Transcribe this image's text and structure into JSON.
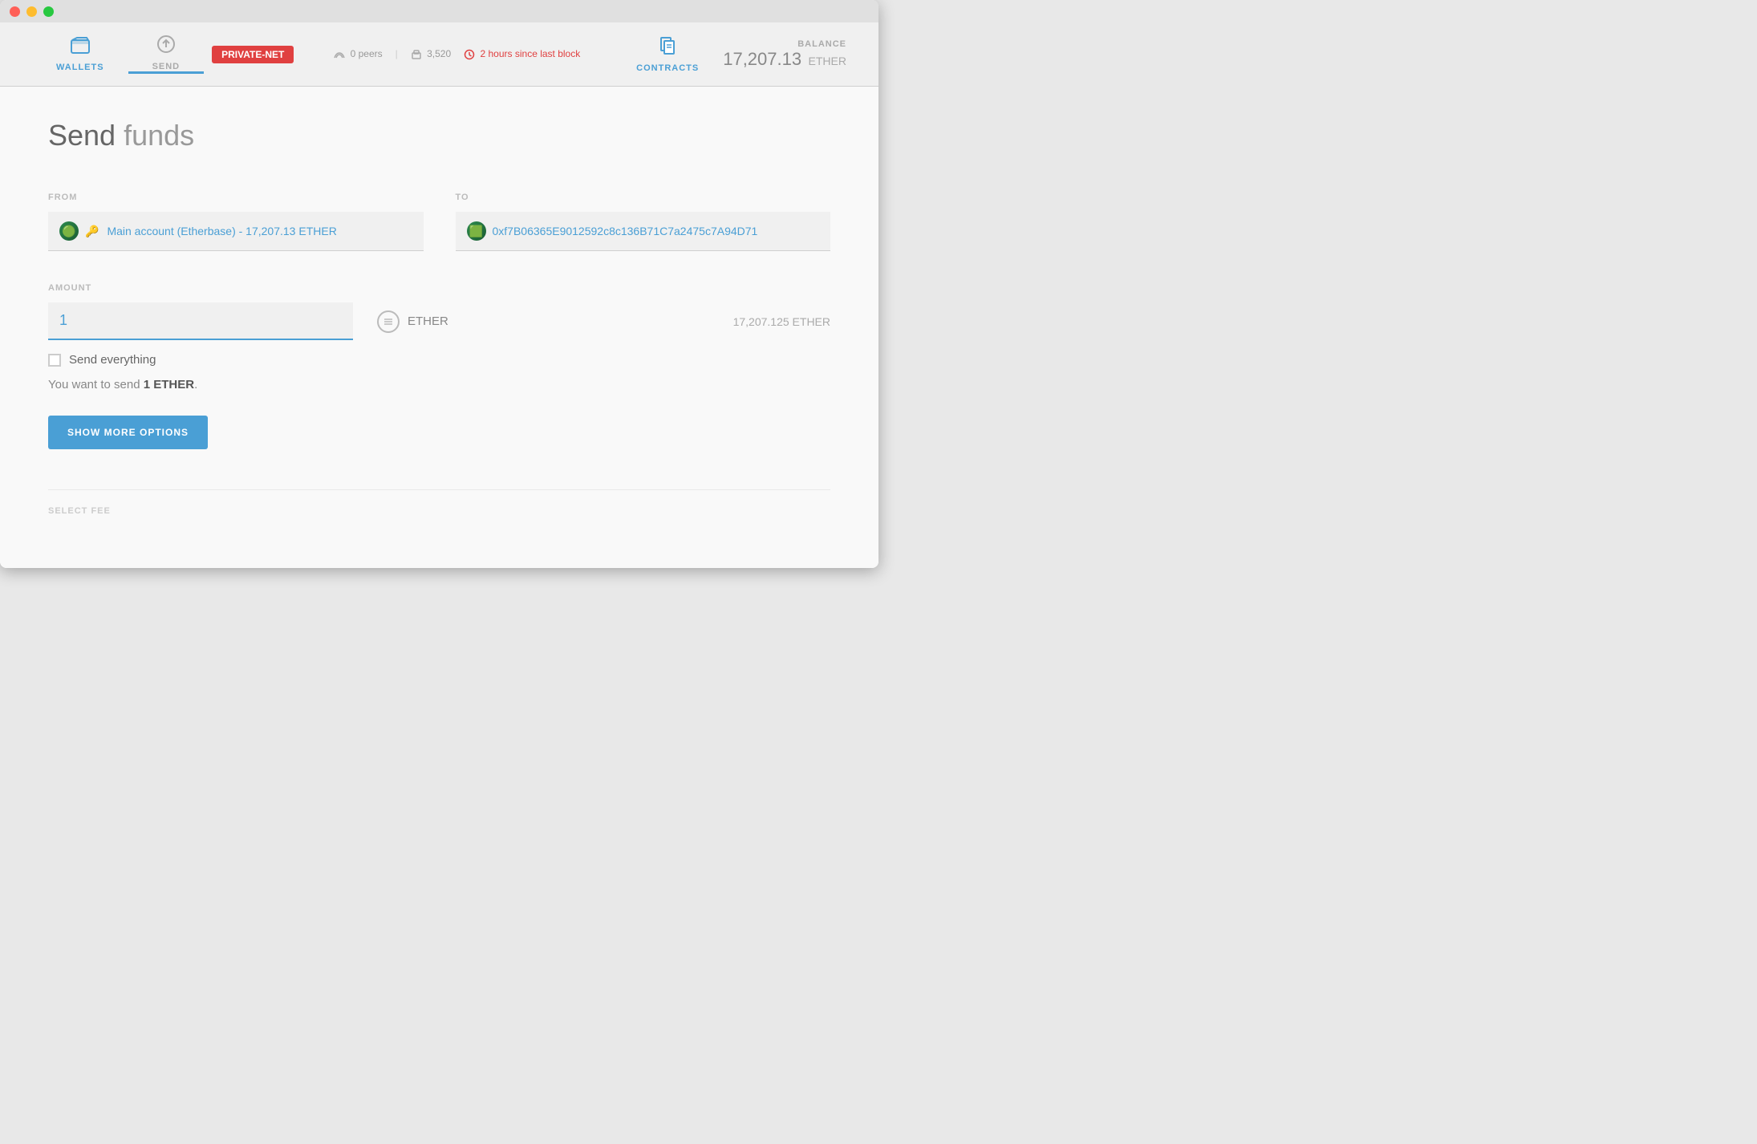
{
  "window": {
    "traffic": {
      "close": "close",
      "minimize": "minimize",
      "maximize": "maximize"
    }
  },
  "navbar": {
    "wallets_label": "WALLETS",
    "send_label": "SEND",
    "network_badge": "PRIVATE-NET",
    "status": {
      "peers": "0 peers",
      "blocks": "3,520",
      "time": "2 hours since last block"
    },
    "contracts_label": "CONTRACTS",
    "balance_label": "BALANCE",
    "balance_value": "17,207.13",
    "balance_currency": "ETHER"
  },
  "page": {
    "title_bold": "Send",
    "title_light": " funds"
  },
  "form": {
    "from_label": "FROM",
    "from_account": "Main account (Etherbase) - 17,207.13 ETHER",
    "to_label": "TO",
    "to_address": "0xf7B06365E9012592c8c136B71C7a2475c7A94D71",
    "amount_label": "AMOUNT",
    "amount_value": "1",
    "currency_label": "ETHER",
    "available_balance": "17,207.125 ETHER",
    "send_everything_label": "Send everything",
    "send_summary_prefix": "You want to send ",
    "send_summary_bold": "1 ETHER",
    "send_summary_suffix": ".",
    "show_more_options": "SHOW MORE OPTIONS",
    "select_fee_label": "SELECT FEE"
  }
}
